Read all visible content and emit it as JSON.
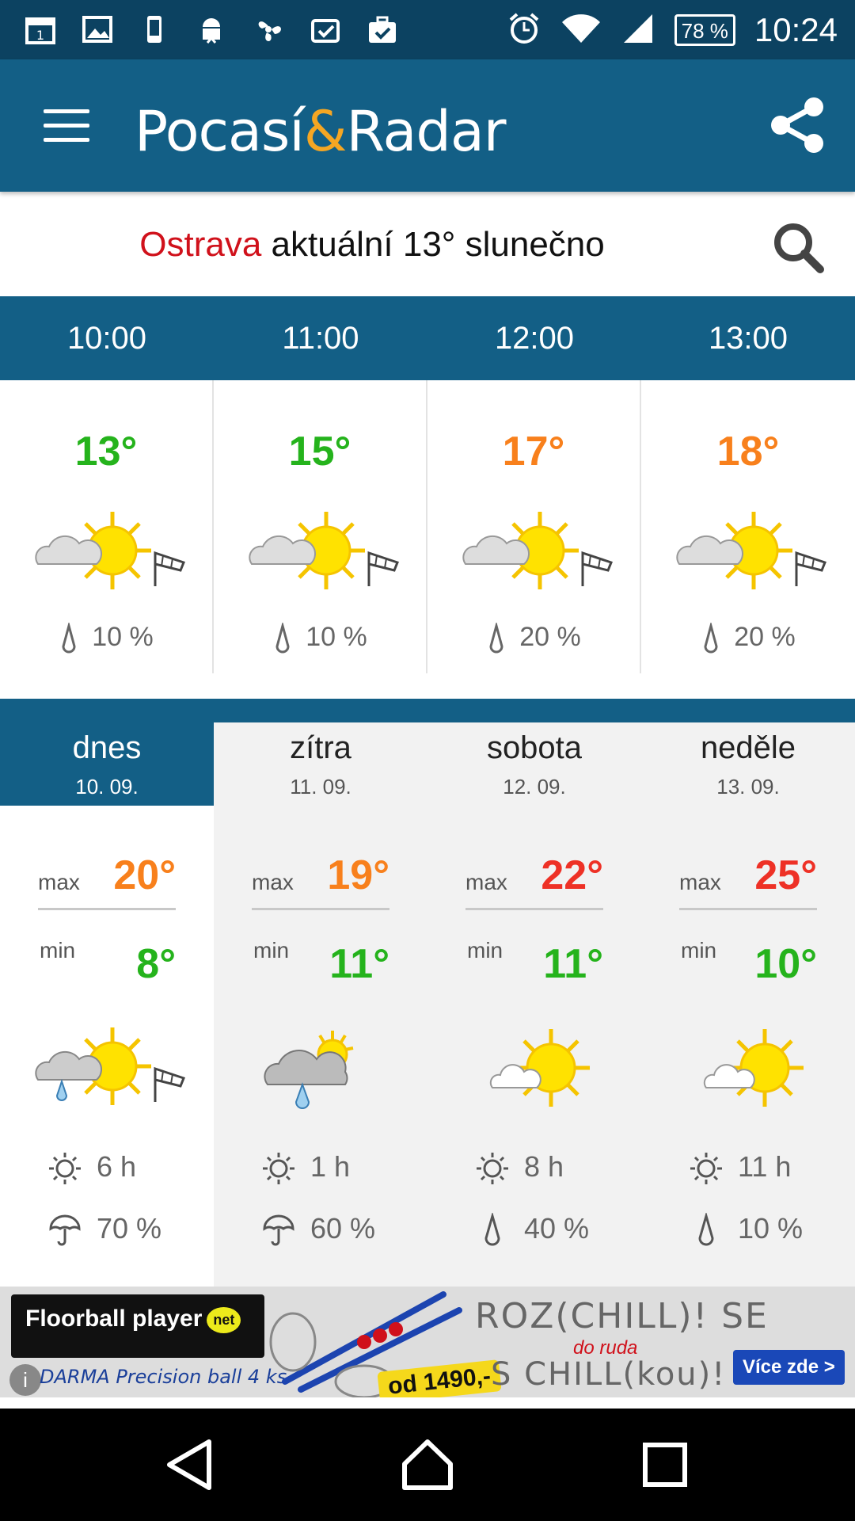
{
  "status_bar": {
    "battery": "78 %",
    "time": "10:24"
  },
  "app_bar": {
    "logo_part1": "Pocasí",
    "logo_amp": "&",
    "logo_part2": "Radar"
  },
  "current": {
    "city": "Ostrava",
    "summary": " aktuální 13° slunečno"
  },
  "hourly": [
    {
      "time": "10:00",
      "temp": "13°",
      "color": "#25b31c",
      "precip": "10 %"
    },
    {
      "time": "11:00",
      "temp": "15°",
      "color": "#25b31c",
      "precip": "10 %"
    },
    {
      "time": "12:00",
      "temp": "17°",
      "color": "#f8801c",
      "precip": "20 %"
    },
    {
      "time": "13:00",
      "temp": "18°",
      "color": "#f8801c",
      "precip": "20 %"
    }
  ],
  "daily": [
    {
      "name": "dnes",
      "date": "10. 09.",
      "max_label": "max",
      "max": "20°",
      "min_label": "min",
      "min": "8°",
      "sun": "6 h",
      "rain": "70 %",
      "rain_icon": "umbrella-icon"
    },
    {
      "name": "zítra",
      "date": "11. 09.",
      "max_label": "max",
      "max": "19°",
      "min_label": "min",
      "min": "11°",
      "sun": "1 h",
      "rain": "60 %",
      "rain_icon": "umbrella-icon"
    },
    {
      "name": "sobota",
      "date": "12. 09.",
      "max_label": "max",
      "max": "22°",
      "min_label": "min",
      "min": "11°",
      "sun": "8 h",
      "rain": "40 %",
      "rain_icon": "drop-icon"
    },
    {
      "name": "neděle",
      "date": "13. 09.",
      "max_label": "max",
      "max": "25°",
      "min_label": "min",
      "min": "10°",
      "sun": "11 h",
      "rain": "10 %",
      "rain_icon": "drop-icon"
    }
  ],
  "ad": {
    "brand": "Floorball player",
    "brand_badge": "net",
    "product": "DARMA Precision ball 4 ks",
    "price": "od 1490,-",
    "slogan_line1": "ROZ(CHILL)! SE",
    "slogan_small": "do ruda",
    "slogan_line2": "S CHILL(kou)!",
    "cta": "Více zde >"
  },
  "colors": {
    "primary": "#135f86",
    "status_bar": "#0c4261",
    "accent": "#f5a623",
    "city": "#d0111b",
    "green": "#25b31c",
    "orange": "#f8801c",
    "red": "#ee3126"
  }
}
